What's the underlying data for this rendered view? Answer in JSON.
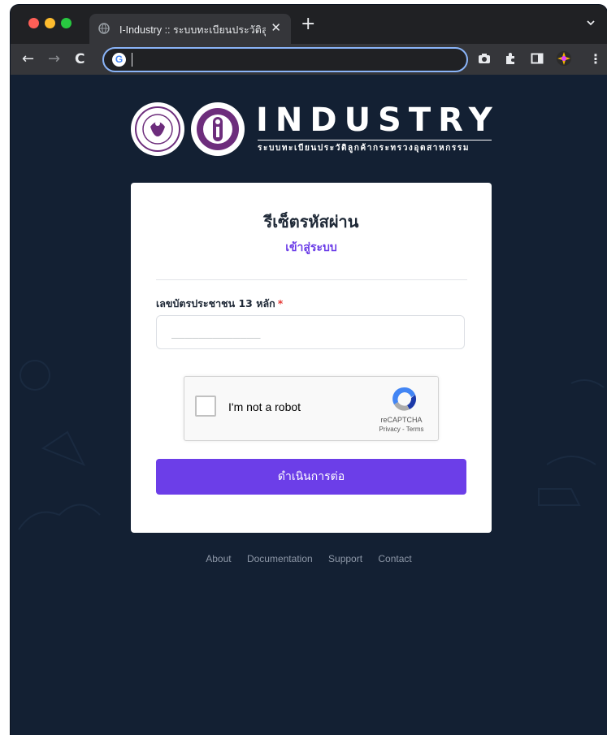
{
  "browser": {
    "tab_title": "I-Industry :: ระบบทะเบียนประวัติลู",
    "tab_close": "✕",
    "new_tab": "+",
    "address_value": ""
  },
  "brand": {
    "title": "INDUSTRY",
    "subtitle": "ระบบทะเบียนประวัติลูกค้ากระทรวงอุตสาหกรรม"
  },
  "card": {
    "title": "รีเซ็ตรหัสผ่าน",
    "login_link": "เข้าสู่ระบบ",
    "id_label": "เลขบัตรประชาชน 13 หลัก",
    "required_mark": "*",
    "id_placeholder": "_____________",
    "id_value": "",
    "submit_label": "ดำเนินการต่อ"
  },
  "recaptcha": {
    "label": "I'm not a robot",
    "brand": "reCAPTCHA",
    "links": "Privacy - Terms"
  },
  "footer": {
    "links": [
      "About",
      "Documentation",
      "Support",
      "Contact"
    ]
  },
  "colors": {
    "page_bg": "#132033",
    "accent": "#6c3ee8",
    "card_bg": "#ffffff",
    "required": "#e53935"
  }
}
